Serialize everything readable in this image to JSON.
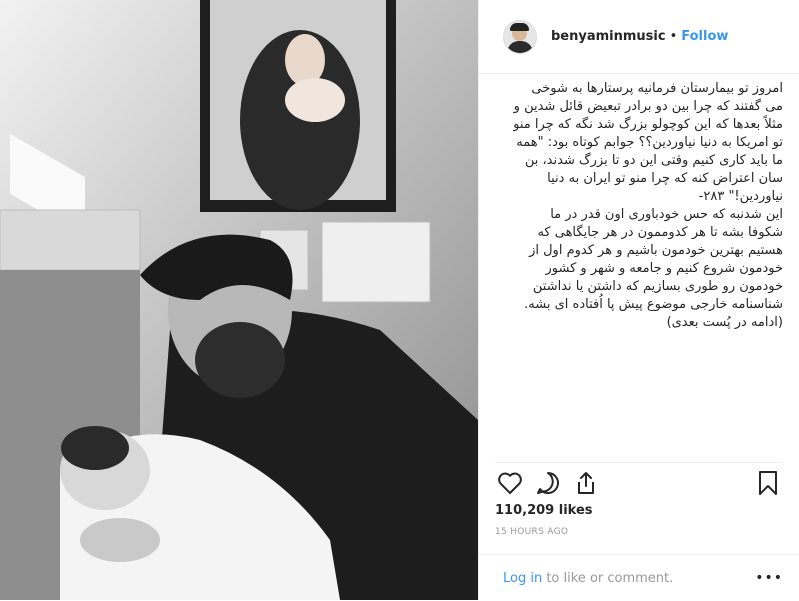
{
  "post": {
    "username": "benyaminmusic",
    "separator": "•",
    "follow_label": "Follow",
    "caption": [
      "امروز تو بیمارستان فرمانیه پرستارها به شوخی می گفتند که چرا بین دو برادر تبعیض قائل شدین و مثلاً بعدها که این کوچولو بزرگ شد نگه که چرا منو تو امریکا به دنیا نیاوردین؟؟ جوابم کوتاه بود: \"همه ما باید کاری کنیم وقتی این دو تا بزرگ شدند، بن سان اعتراض کنه که چرا منو تو ایران به دنیا نیاوردین!\" ۲۸۳-",
      "این شدنبه که حس خودباوری اون قدر در ما شکوفا بشه تا هر کدوممون در هر جایگاهی که هستیم بهترین خودمون باشیم و هر کدوم اول از خودمون شروع کنیم و جامعه و شهر و کشور خودمون رو طوری بسازیم که داشتن یا نداشتن شناسنامه خارجی موضوع پیش پا اُفتاده ای بشه. (ادامه در پُست بعدی)"
    ],
    "likes": "110,209 likes",
    "timestamp": "15 HOURS AGO",
    "login_link": "Log in",
    "login_suffix": " to like or comment.",
    "more_label": "•••"
  }
}
